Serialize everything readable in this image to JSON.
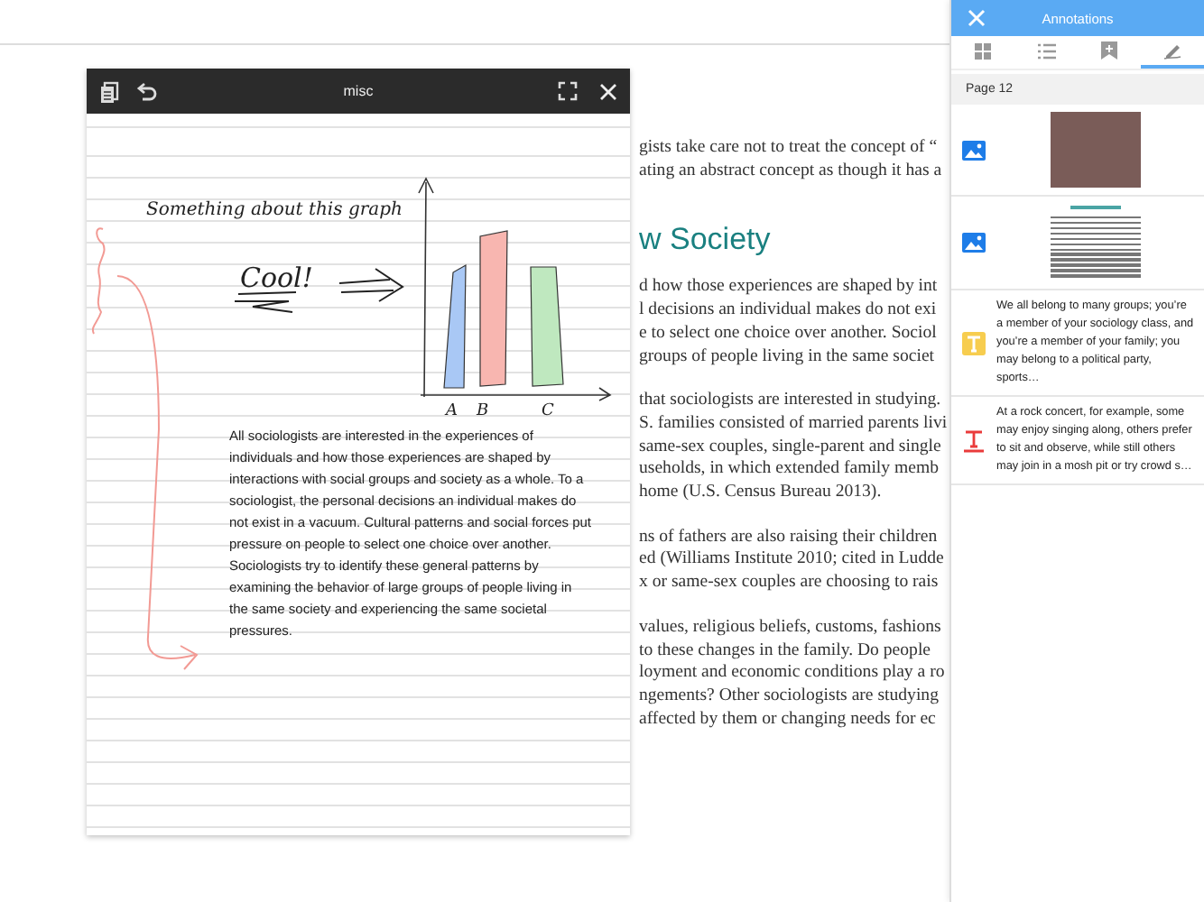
{
  "document": {
    "blocks": [
      {
        "kind": "text",
        "lines": [
          "gists take care not to treat the concept of “",
          "ating an abstract concept as though it has a"
        ]
      },
      {
        "kind": "heading",
        "lines": [
          "w Society"
        ]
      },
      {
        "kind": "text",
        "lines": [
          "d how those experiences are shaped by int",
          "l decisions an individual makes do not exi",
          "e to select one choice over another. Sociol",
          "groups of people living in the same societ"
        ]
      },
      {
        "kind": "text",
        "lines": [
          "that sociologists are interested in studying.",
          "S. families consisted of married parents livi",
          "same-sex couples, single-parent and single",
          "useholds, in which extended family memb",
          "home (U.S. Census Bureau 2013)."
        ]
      },
      {
        "kind": "text",
        "lines": [
          "ns of fathers are also raising their children",
          "ed (Williams Institute 2010; cited in Ludde",
          "x or same-sex couples are choosing to rais"
        ]
      },
      {
        "kind": "text",
        "lines": [
          "values, religious beliefs, customs, fashions",
          "to these changes in the family. Do people",
          "loyment and economic conditions play a ro",
          "ngements? Other sociologists are studying",
          "affected by them or changing needs for ec"
        ]
      }
    ]
  },
  "note_window": {
    "title": "misc",
    "handwriting": [
      "Something about this graph",
      "Cool!"
    ],
    "sketch_labels": [
      "A",
      "B",
      "C"
    ],
    "typed_text": "All sociologists are interested in the experiences of individuals and how those experiences are shaped by interactions with social groups and society as a whole. To a sociologist, the personal decisions an individual makes do not exist in a vacuum. Cultural patterns and social forces put pressure on people to select one choice over another. Sociologists try to identify these general patterns by examining the behavior of large groups of people living in the same society and experiencing the same societal pressures."
  },
  "annotations_panel": {
    "title": "Annotations",
    "tabs": [
      {
        "kind": "thumbnails",
        "selected": false
      },
      {
        "kind": "outline",
        "selected": false
      },
      {
        "kind": "bookmarks",
        "selected": false
      },
      {
        "kind": "annotations",
        "selected": true
      }
    ],
    "page_label": "Page 12",
    "items": [
      {
        "kind": "photo"
      },
      {
        "kind": "page"
      },
      {
        "kind": "note",
        "text": "We all belong to many groups; you’re a member of your sociology class, and you’re a member of your family; you may belong to a political party, sports…"
      },
      {
        "kind": "text",
        "text": "At a rock concert, for example, some may enjoy singing along, others prefer to sit and observe, while still others may join in a mosh pit or try crowd s…"
      }
    ]
  }
}
